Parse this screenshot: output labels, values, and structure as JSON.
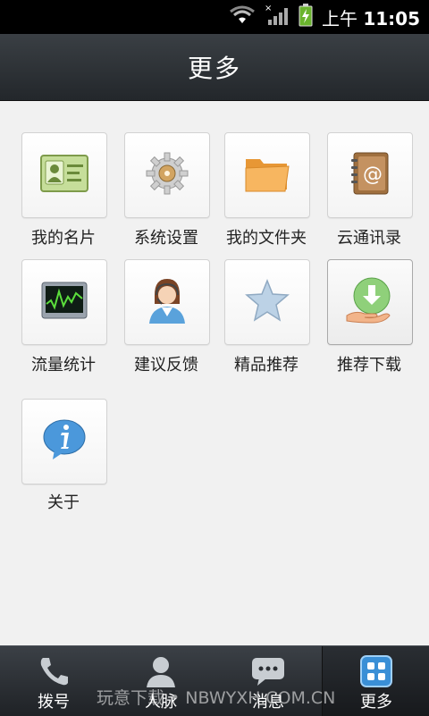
{
  "status_bar": {
    "time_prefix": "上午",
    "time": "11:05",
    "icons": [
      "wifi-icon",
      "signal-icon",
      "battery-charging-icon"
    ]
  },
  "header": {
    "title": "更多"
  },
  "items": [
    {
      "label": "我的名片",
      "icon": "business-card-icon"
    },
    {
      "label": "系统设置",
      "icon": "gear-icon"
    },
    {
      "label": "我的文件夹",
      "icon": "folder-icon"
    },
    {
      "label": "云通讯录",
      "icon": "address-book-icon"
    },
    {
      "label": "流量统计",
      "icon": "traffic-monitor-icon"
    },
    {
      "label": "建议反馈",
      "icon": "support-agent-icon"
    },
    {
      "label": "精品推荐",
      "icon": "star-icon"
    },
    {
      "label": "推荐下载",
      "icon": "download-hand-icon"
    },
    {
      "label": "关于",
      "icon": "info-bubble-icon"
    }
  ],
  "bottom_tabs": [
    {
      "label": "拨号",
      "icon": "phone-icon",
      "active": false
    },
    {
      "label": "人脉",
      "icon": "contact-person-icon",
      "active": false
    },
    {
      "label": "消息",
      "icon": "message-bubble-icon",
      "active": false
    },
    {
      "label": "更多",
      "icon": "grid-more-icon",
      "active": true
    }
  ],
  "watermark": "玩意下载 • NBWYXH.COM.CN",
  "colors": {
    "titlebar": "#2d3237",
    "background": "#f1f1f1",
    "active_tab_icon": "#4a9fe0"
  }
}
